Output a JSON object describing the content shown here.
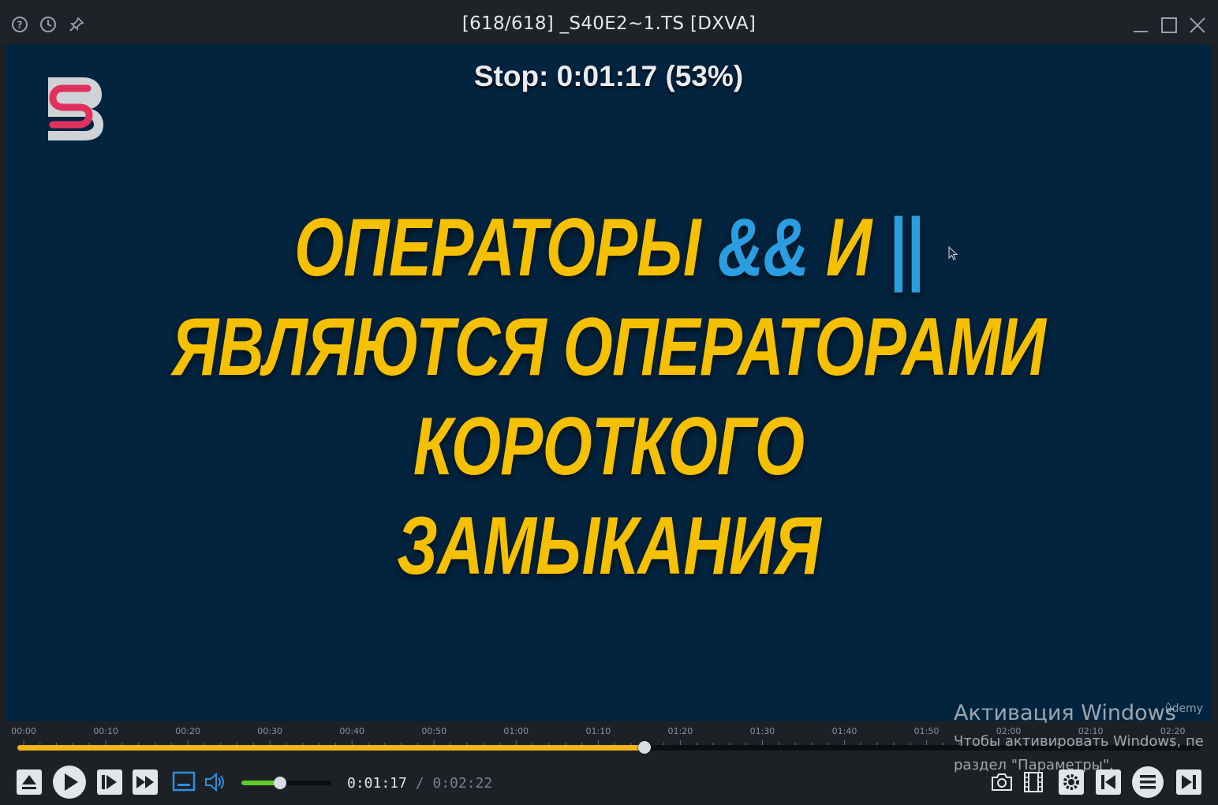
{
  "window": {
    "title": "[618/618] _S40E2~1.TS [DXVA]",
    "left_icons": [
      "help-icon",
      "history-icon",
      "pin-icon"
    ],
    "controls": [
      "minimize-icon",
      "maximize-icon",
      "close-icon"
    ]
  },
  "video": {
    "osd_text": "Stop: 0:01:17 (53%)",
    "headline": {
      "line1_a": "ОПЕРАТОРЫ ",
      "line1_b": "&&",
      "line1_c": " И ",
      "line1_d": "||",
      "line2": "ЯВЛЯЮТСЯ ОПЕРАТОРАМИ",
      "line3": "КОРОТКОГО",
      "line4": "ЗАМЫКАНИЯ"
    },
    "watermark": "ûdemy",
    "colors": {
      "background": "#03243f",
      "headline": "#f5c000",
      "operator": "#2a9ee0"
    }
  },
  "timeline": {
    "tick_labels": [
      "00:00",
      "00:10",
      "00:20",
      "00:30",
      "00:40",
      "00:50",
      "01:00",
      "01:10",
      "01:20",
      "01:30",
      "01:40",
      "01:50",
      "02:00",
      "02:10",
      "02:20"
    ],
    "progress_percent": 53,
    "accent": "#f3b51b"
  },
  "controls": {
    "current_time": "0:01:17",
    "separator": " / ",
    "total_time": "0:02:22",
    "volume_level": 0.43,
    "left_buttons": [
      "eject-icon",
      "play-icon",
      "frame-step-icon",
      "fast-forward-icon",
      "subtitle-icon",
      "volume-icon"
    ],
    "right_buttons": [
      "screenshot-icon",
      "film-icon",
      "settings-icon",
      "previous-icon",
      "playlist-icon",
      "next-icon"
    ]
  },
  "activation": {
    "title": "Активация Windows",
    "line1": "Чтобы активировать Windows, пе",
    "line2": "раздел \"Параметры\"."
  }
}
